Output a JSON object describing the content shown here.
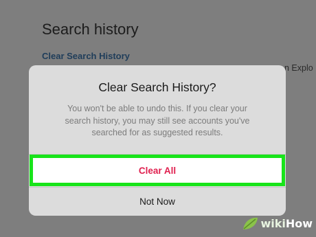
{
  "background": {
    "title": "Search history",
    "clear_link": "Clear Search History",
    "clipped_text": "n Explo"
  },
  "dialog": {
    "title": "Clear Search History?",
    "message": "You won't be able to undo this. If you clear your search history, you may still see accounts you've searched for as suggested results.",
    "primary_label": "Clear All",
    "secondary_label": "Not Now"
  },
  "colors": {
    "primary_label": "#e0204f",
    "highlight": "#18e41a",
    "dialog_bg": "#dcdcdc"
  },
  "watermark": {
    "part1": "wiki",
    "part2": "How"
  }
}
